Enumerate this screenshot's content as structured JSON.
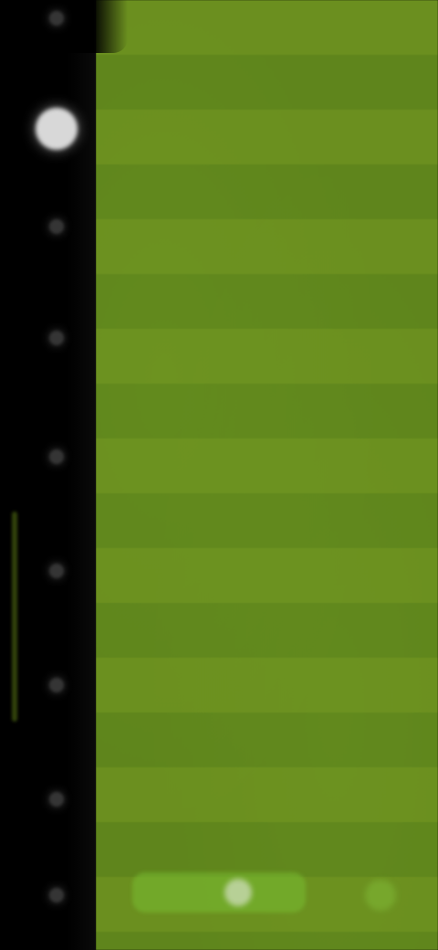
{
  "colors": {
    "rail_background": "#000000",
    "canvas_green_primary": "#6b8f1f",
    "canvas_green_stripe": "#5f851c",
    "highlight": "#e0e0e0"
  },
  "left_rail": {
    "icons": [
      "unknown-icon",
      "primary-circle-icon",
      "unknown-icon",
      "unknown-icon",
      "unknown-icon",
      "unknown-icon",
      "unknown-icon",
      "unknown-icon",
      "unknown-icon"
    ]
  },
  "bottom_controls": {
    "slider_icon": "slider-knob-icon",
    "right_icon": "circle-button-icon"
  }
}
